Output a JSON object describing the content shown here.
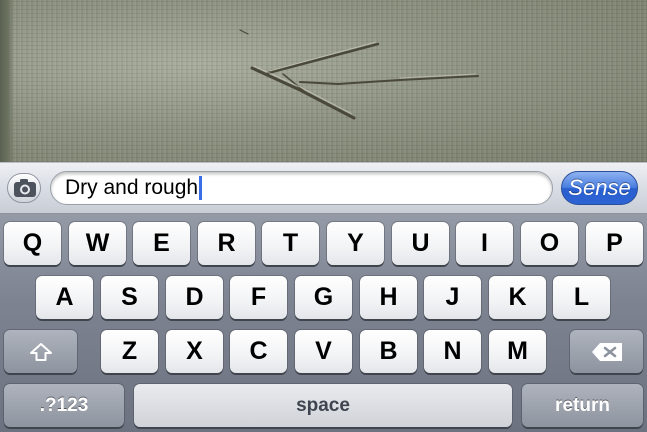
{
  "input_bar": {
    "text_value": "Dry and rough",
    "action_label": "Sense",
    "camera_icon": "camera-icon"
  },
  "keyboard": {
    "row1": [
      "Q",
      "W",
      "E",
      "R",
      "T",
      "Y",
      "U",
      "I",
      "O",
      "P"
    ],
    "row2": [
      "A",
      "S",
      "D",
      "F",
      "G",
      "H",
      "J",
      "K",
      "L"
    ],
    "row3": [
      "Z",
      "X",
      "C",
      "V",
      "B",
      "N",
      "M"
    ],
    "numbers_label": ".?123",
    "space_label": "space",
    "return_label": "return",
    "shift_icon": "shift-arrow-icon",
    "delete_icon": "backspace-icon"
  },
  "colors": {
    "sense_button": "#2d63d3",
    "cursor": "#3a6ee6"
  }
}
